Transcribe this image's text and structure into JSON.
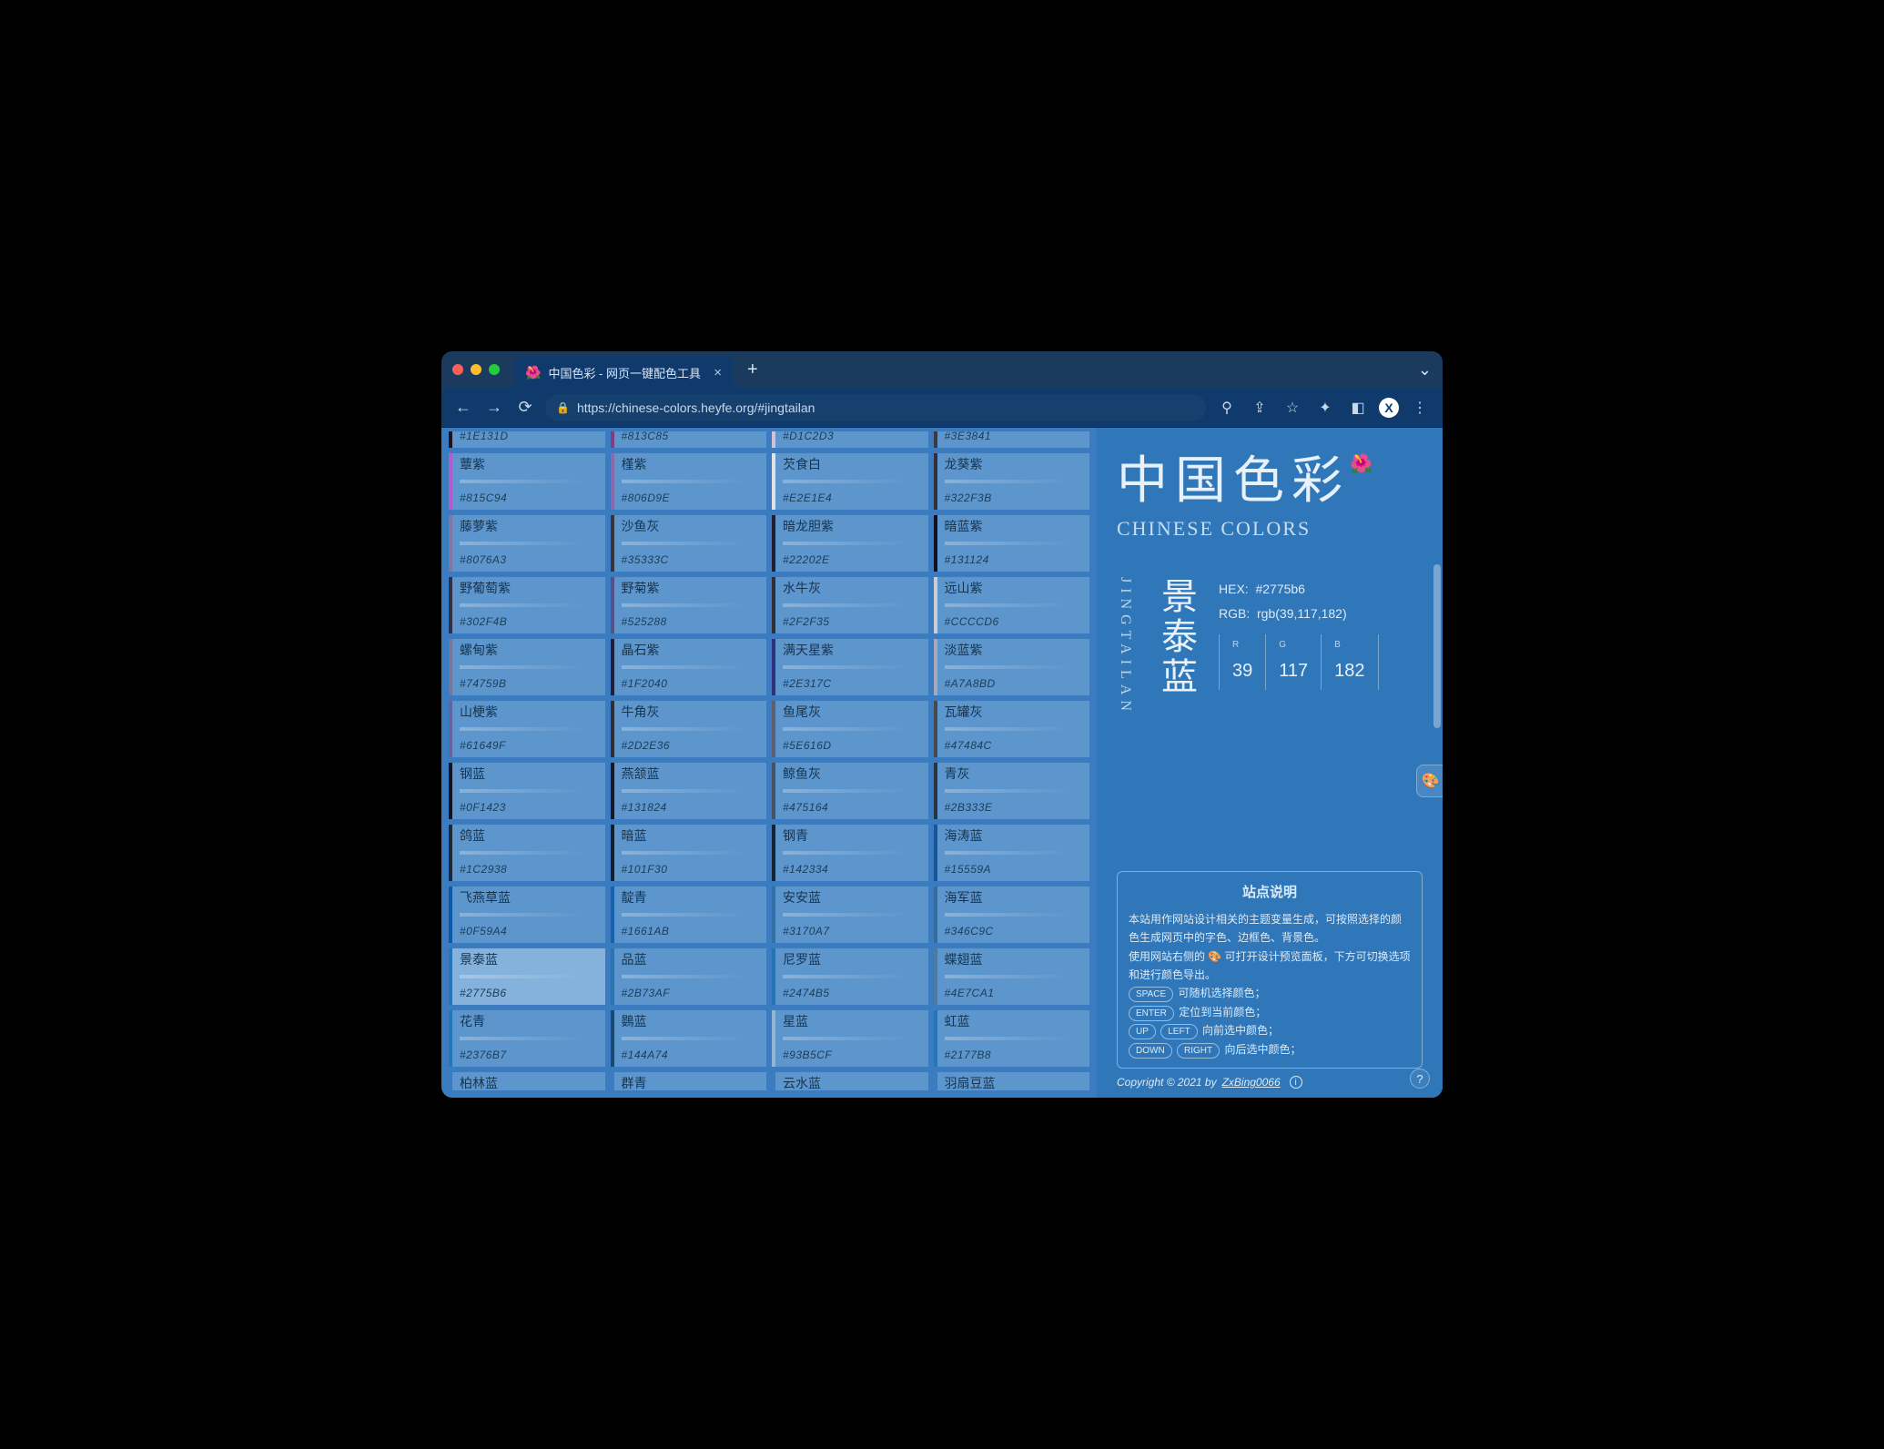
{
  "browser": {
    "tab_title": "中国色彩 - 网页一键配色工具",
    "url": "https://chinese-colors.heyfe.org/#jingtailan",
    "profile_letter": "X"
  },
  "site": {
    "title": "中国色彩",
    "subtitle": "CHINESE COLORS"
  },
  "selected_color": {
    "name_cn": "景泰蓝",
    "pinyin": "JINGTAILAN",
    "hex_label": "HEX:",
    "hex": "#2775b6",
    "rgb_label": "RGB:",
    "rgb_text": "rgb(39,117,182)",
    "r": 39,
    "g": 117,
    "b": 182
  },
  "help": {
    "title": "站点说明",
    "line1": "本站用作网站设计相关的主题变量生成，可按照选择的颜色生成网页中的字色、边框色、背景色。",
    "line2": "使用网站右侧的 🎨 可打开设计预览面板，下方可切换选项和进行颜色导出。",
    "space_key": "SPACE",
    "space_txt": "可随机选择颜色；",
    "enter_key": "ENTER",
    "enter_txt": "定位到当前颜色；",
    "up_key": "UP",
    "left_key": "LEFT",
    "upleft_txt": "向前选中颜色；",
    "down_key": "DOWN",
    "right_key": "RIGHT",
    "downright_txt": "向后选中颜色；"
  },
  "copyright": {
    "prefix": "Copyright © 2021 by",
    "author": "ZxBing0066"
  },
  "grid": {
    "row0": [
      {
        "hex": "#1E131D"
      },
      {
        "hex": "#813C85"
      },
      {
        "hex": "#D1C2D3"
      },
      {
        "hex": "#3E3841"
      }
    ],
    "rows": [
      [
        {
          "name": "蕈紫",
          "hex": "#815C94",
          "swatch": "#b25bcf"
        },
        {
          "name": "槿紫",
          "hex": "#806D9E",
          "swatch": "#8a6aa8"
        },
        {
          "name": "芡食白",
          "hex": "#E2E1E4",
          "swatch": "#e2e1e4"
        },
        {
          "name": "龙葵紫",
          "hex": "#322F3B",
          "swatch": "#322f3b"
        }
      ],
      [
        {
          "name": "藤萝紫",
          "hex": "#8076A3",
          "swatch": "#8076a3"
        },
        {
          "name": "沙鱼灰",
          "hex": "#35333C",
          "swatch": "#35333c"
        },
        {
          "name": "暗龙胆紫",
          "hex": "#22202E",
          "swatch": "#22202e"
        },
        {
          "name": "暗蓝紫",
          "hex": "#131124",
          "swatch": "#131124"
        }
      ],
      [
        {
          "name": "野葡萄紫",
          "hex": "#302F4B",
          "swatch": "#302f4b"
        },
        {
          "name": "野菊紫",
          "hex": "#525288",
          "swatch": "#525288"
        },
        {
          "name": "水牛灰",
          "hex": "#2F2F35",
          "swatch": "#2f2f35"
        },
        {
          "name": "远山紫",
          "hex": "#CCCCD6",
          "swatch": "#ccccd6"
        }
      ],
      [
        {
          "name": "螺甸紫",
          "hex": "#74759B",
          "swatch": "#74759b"
        },
        {
          "name": "晶石紫",
          "hex": "#1F2040",
          "swatch": "#1f2040"
        },
        {
          "name": "满天星紫",
          "hex": "#2E317C",
          "swatch": "#2e317c"
        },
        {
          "name": "淡蓝紫",
          "hex": "#A7A8BD",
          "swatch": "#a7a8bd"
        }
      ],
      [
        {
          "name": "山梗紫",
          "hex": "#61649F",
          "swatch": "#61649f"
        },
        {
          "name": "牛角灰",
          "hex": "#2D2E36",
          "swatch": "#2d2e36"
        },
        {
          "name": "鱼尾灰",
          "hex": "#5E616D",
          "swatch": "#5e616d"
        },
        {
          "name": "瓦罐灰",
          "hex": "#47484C",
          "swatch": "#47484c"
        }
      ],
      [
        {
          "name": "钢蓝",
          "hex": "#0F1423",
          "swatch": "#0f1423"
        },
        {
          "name": "燕颔蓝",
          "hex": "#131824",
          "swatch": "#131824"
        },
        {
          "name": "鲸鱼灰",
          "hex": "#475164",
          "swatch": "#475164"
        },
        {
          "name": "青灰",
          "hex": "#2B333E",
          "swatch": "#2b333e"
        }
      ],
      [
        {
          "name": "鸽蓝",
          "hex": "#1C2938",
          "swatch": "#1c2938"
        },
        {
          "name": "暗蓝",
          "hex": "#101F30",
          "swatch": "#101f30"
        },
        {
          "name": "钢青",
          "hex": "#142334",
          "swatch": "#142334"
        },
        {
          "name": "海涛蓝",
          "hex": "#15559A",
          "swatch": "#15559a"
        }
      ],
      [
        {
          "name": "飞燕草蓝",
          "hex": "#0F59A4",
          "swatch": "#0f59a4"
        },
        {
          "name": "靛青",
          "hex": "#1661AB",
          "swatch": "#1661ab"
        },
        {
          "name": "安安蓝",
          "hex": "#3170A7",
          "swatch": "#3170a7"
        },
        {
          "name": "海军蓝",
          "hex": "#346C9C",
          "swatch": "#346c9c"
        }
      ],
      [
        {
          "name": "景泰蓝",
          "hex": "#2775B6",
          "swatch": "#2775b6",
          "selected": true
        },
        {
          "name": "品蓝",
          "hex": "#2B73AF",
          "swatch": "#2b73af"
        },
        {
          "name": "尼罗蓝",
          "hex": "#2474B5",
          "swatch": "#2474b5"
        },
        {
          "name": "蝶翅蓝",
          "hex": "#4E7CA1",
          "swatch": "#4e7ca1"
        }
      ],
      [
        {
          "name": "花青",
          "hex": "#2376B7",
          "swatch": "#2376b7"
        },
        {
          "name": "鷃蓝",
          "hex": "#144A74",
          "swatch": "#144a74"
        },
        {
          "name": "星蓝",
          "hex": "#93B5CF",
          "swatch": "#93b5cf"
        },
        {
          "name": "虹蓝",
          "hex": "#2177B8",
          "swatch": "#2177b8"
        }
      ]
    ],
    "rowLast": [
      {
        "name": "柏林蓝"
      },
      {
        "name": "群青"
      },
      {
        "name": "云水蓝"
      },
      {
        "name": "羽扇豆蓝"
      }
    ]
  }
}
